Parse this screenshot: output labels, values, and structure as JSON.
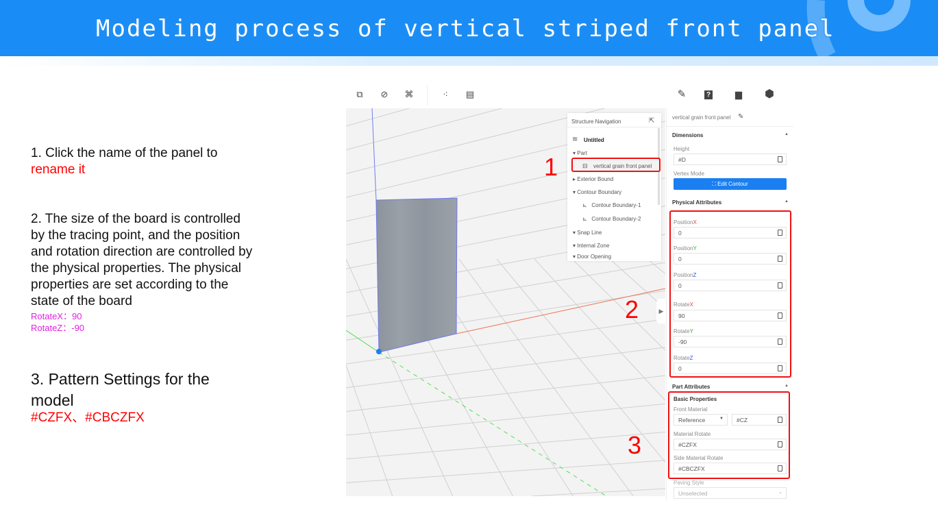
{
  "banner": {
    "title": "Modeling process of vertical striped front panel"
  },
  "instructions": {
    "step1_line1": "1. Click the name of the panel to",
    "step1_line2": "rename it",
    "step2_lines": [
      "2. The size of the board is controlled",
      "by the tracing point, and the position",
      "and rotation direction are controlled by",
      "the physical properties. The physical",
      "properties are set according to the",
      "state of the board"
    ],
    "step2_rotate_x": "RotateX：90",
    "step2_rotate_z": "RotateZ：-90",
    "step3_line1": "3. Pattern Settings for the",
    "step3_line2": "model",
    "step3_codes": "#CZFX、#CBCZFX"
  },
  "annotations": {
    "n1": "1",
    "n2": "2",
    "n3": "3"
  },
  "structure_nav": {
    "title": "Structure Navigation",
    "root": "Untitled",
    "items": [
      "Part",
      "vertical grain front panel",
      "Exterior Bound",
      "Contour Boundary",
      "Contour Boundary-1",
      "Contour Boundary-2",
      "Snap Line",
      "Internal Zone",
      "Door Opening"
    ]
  },
  "properties": {
    "part_name": "vertical grain front panel",
    "dimensions": {
      "title": "Dimensions",
      "height_label": "Height",
      "height_value": "#D",
      "vertex_label": "Vertex Mode",
      "edit_contour": "Edit Contour"
    },
    "physical": {
      "title": "Physical Attributes",
      "fields": [
        {
          "label": "Position",
          "axis": "X",
          "value": "0"
        },
        {
          "label": "Position",
          "axis": "Y",
          "value": "0"
        },
        {
          "label": "Position",
          "axis": "Z",
          "value": "0"
        },
        {
          "label": "Rotate",
          "axis": "X",
          "value": "90"
        },
        {
          "label": "Rotate",
          "axis": "Y",
          "value": "-90"
        },
        {
          "label": "Rotate",
          "axis": "Z",
          "value": "0"
        }
      ]
    },
    "part": {
      "title": "Part Attributes",
      "basic": "Basic Properties",
      "front_material_label": "Front Material",
      "front_material_select": "Reference",
      "front_material_value": "#CZ",
      "material_rotate_label": "Material Rotate",
      "material_rotate_value": "#CZFX",
      "side_rotate_label": "Side Material Rotate",
      "side_rotate_value": "#CBCZFX",
      "paving_label": "Paving Style",
      "paving_value": "Unselected"
    }
  },
  "colors": {
    "accent": "#1a7ff0",
    "axis_x": "#f04040",
    "axis_y": "#2fae2f",
    "axis_z": "#3050ff",
    "highlight": "#f01010"
  }
}
